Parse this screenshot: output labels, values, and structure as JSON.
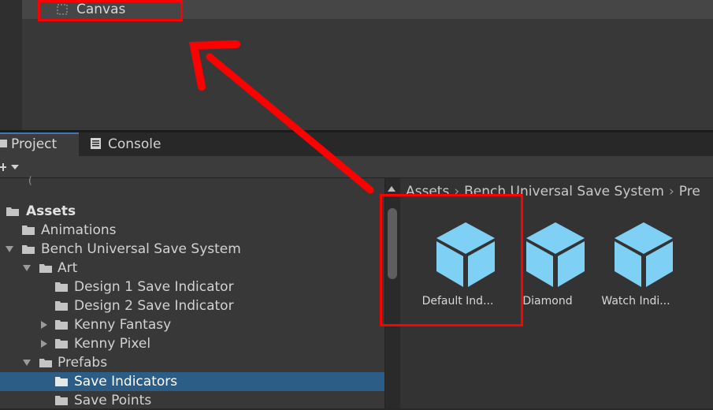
{
  "hierarchy": {
    "canvas_label": "Canvas"
  },
  "tabs": [
    {
      "label": "Project",
      "icon": "folder-icon",
      "active": true
    },
    {
      "label": "Console",
      "icon": "console-icon",
      "active": false
    }
  ],
  "tree": {
    "partial_top": "(",
    "items": [
      {
        "label": "Assets",
        "depth": 0,
        "expanded": true
      },
      {
        "label": "Animations",
        "depth": 1
      },
      {
        "label": "Bench Universal Save System",
        "depth": 1,
        "expanded": true
      },
      {
        "label": "Art",
        "depth": 2,
        "expanded": true
      },
      {
        "label": "Design 1 Save Indicator",
        "depth": 3
      },
      {
        "label": "Design 2 Save Indicator",
        "depth": 3
      },
      {
        "label": "Kenny Fantasy",
        "depth": 3,
        "expanded": false
      },
      {
        "label": "Kenny Pixel",
        "depth": 3,
        "expanded": false
      },
      {
        "label": "Prefabs",
        "depth": 2,
        "expanded": true
      },
      {
        "label": "Save Indicators",
        "depth": 3,
        "selected": true
      },
      {
        "label": "Save Points",
        "depth": 3
      }
    ]
  },
  "breadcrumb": [
    "Assets",
    "Bench Universal Save System",
    "Pre"
  ],
  "assets": [
    {
      "label": "Default Ind...",
      "icon": "prefab-cube-icon"
    },
    {
      "label": "Diamond",
      "icon": "prefab-cube-icon"
    },
    {
      "label": "Watch Indi...",
      "icon": "prefab-cube-icon"
    }
  ],
  "colors": {
    "selection": "#2c5d87",
    "annotation_red": "#ff0000",
    "prefab_cube": "#7fd0f5"
  }
}
